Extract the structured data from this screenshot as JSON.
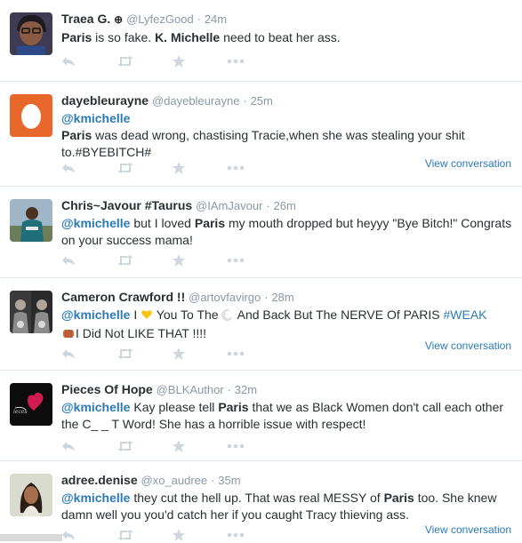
{
  "tweets": [
    {
      "name": "Traea G.",
      "badge": "⊕",
      "handle": "@LyfezGood",
      "time": "24m",
      "segments": [
        {
          "t": "b",
          "v": "Paris"
        },
        {
          "t": "n",
          "v": " is so fake. "
        },
        {
          "t": "b",
          "v": "K. Michelle"
        },
        {
          "t": "n",
          "v": " need to beat her ass."
        }
      ],
      "view_conversation": ""
    },
    {
      "name": "dayebleurayne",
      "handle": "@dayebleurayne",
      "time": "25m",
      "segments": [
        {
          "t": "m",
          "v": "@kmichelle"
        },
        {
          "t": "br",
          "v": ""
        },
        {
          "t": "b",
          "v": "Paris"
        },
        {
          "t": "n",
          "v": " was dead wrong,  chastising Tracie,when she was stealing your shit to.#BYEBITCH#"
        }
      ],
      "view_conversation": "View conversation"
    },
    {
      "name": "Chris~Javour #Taurus",
      "handle": "@IAmJavour",
      "time": "26m",
      "segments": [
        {
          "t": "m",
          "v": "@kmichelle"
        },
        {
          "t": "n",
          "v": " but I loved "
        },
        {
          "t": "b",
          "v": "Paris"
        },
        {
          "t": "n",
          "v": " my mouth dropped but heyyy \"Bye Bitch!\" Congrats on your success mama!"
        }
      ],
      "view_conversation": ""
    },
    {
      "name": "Cameron Crawford !!",
      "handle": "@artovfavirgo",
      "time": "28m",
      "segments": [
        {
          "t": "m",
          "v": "@kmichelle"
        },
        {
          "t": "n",
          "v": " I "
        },
        {
          "t": "e",
          "v": "heart"
        },
        {
          "t": "n",
          "v": " You To The "
        },
        {
          "t": "e",
          "v": "moon"
        },
        {
          "t": "n",
          "v": " And Back But The NERVE Of PARIS "
        },
        {
          "t": "h",
          "v": "#WEAK"
        },
        {
          "t": "br",
          "v": ""
        },
        {
          "t": "e",
          "v": "fist"
        },
        {
          "t": "n",
          "v": "I Did Not LIKE THAT !!!!"
        }
      ],
      "view_conversation": "View conversation"
    },
    {
      "name": "Pieces Of Hope",
      "handle": "@BLKAuthor",
      "time": "32m",
      "segments": [
        {
          "t": "m",
          "v": "@kmichelle"
        },
        {
          "t": "n",
          "v": " Kay please tell "
        },
        {
          "t": "b",
          "v": "Paris"
        },
        {
          "t": "n",
          "v": " that we as Black Women don't call each other the C_ _ T Word! She has a horrible issue with respect!"
        }
      ],
      "view_conversation": ""
    },
    {
      "name": "adree.denise",
      "handle": "@xo_audree",
      "time": "35m",
      "segments": [
        {
          "t": "m",
          "v": "@kmichelle"
        },
        {
          "t": "n",
          "v": " they cut the hell up. That was real MESSY of "
        },
        {
          "t": "b",
          "v": "Paris"
        },
        {
          "t": "n",
          "v": " too. She knew damn well you you'd catch her if you caught Tracy thieving ass."
        }
      ],
      "view_conversation": "View conversation"
    }
  ],
  "icons": {
    "reply": "reply-icon",
    "retweet": "retweet-icon",
    "favorite": "favorite-icon",
    "more": "more-icon"
  },
  "colors": {
    "link": "#2b7bb9",
    "muted": "#8899a6",
    "action": "#ccd6dd",
    "border": "#e1e8ed"
  }
}
